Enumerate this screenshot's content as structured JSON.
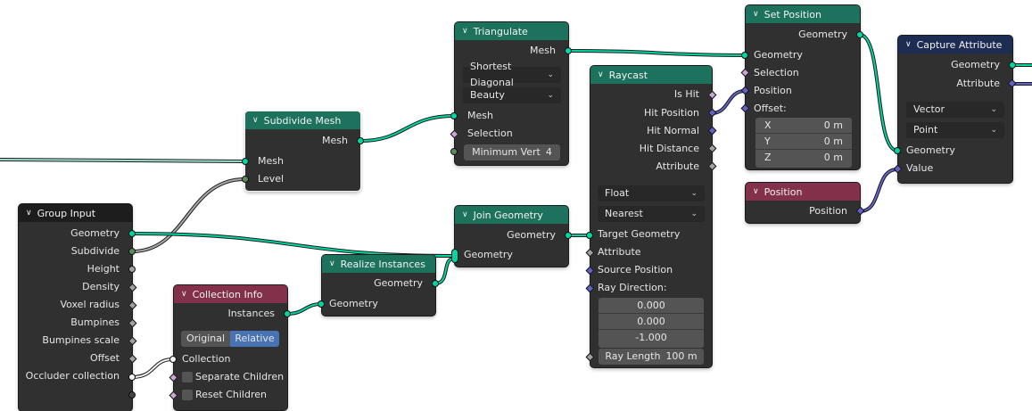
{
  "nodes": {
    "triangulate": {
      "title": "Triangulate",
      "out_mesh": "Mesh",
      "quad_method": "Shortest Diagonal",
      "ngon_method": "Beauty",
      "in_mesh": "Mesh",
      "in_selection": "Selection",
      "min_vert_label": "Minimum Vert",
      "min_vert_value": "4"
    },
    "subdivide": {
      "title": "Subdivide Mesh",
      "out_mesh": "Mesh",
      "in_mesh": "Mesh",
      "in_level": "Level"
    },
    "group_input": {
      "title": "Group Input",
      "outputs": [
        "Geometry",
        "Subdivide",
        "Height",
        "Density",
        "Voxel radius",
        "Bumpines",
        "Bumpines scale",
        "Offset",
        "Occluder collection"
      ]
    },
    "collection_info": {
      "title": "Collection Info",
      "out_instances": "Instances",
      "opt_original": "Original",
      "opt_relative": "Relative",
      "in_collection": "Collection",
      "in_separate": "Separate Children",
      "in_reset": "Reset Children"
    },
    "realize": {
      "title": "Realize Instances",
      "out_geometry": "Geometry",
      "in_geometry": "Geometry"
    },
    "join": {
      "title": "Join Geometry",
      "out_geometry": "Geometry",
      "in_geometry": "Geometry"
    },
    "raycast": {
      "title": "Raycast",
      "outputs": [
        "Is Hit",
        "Hit Position",
        "Hit Normal",
        "Hit Distance",
        "Attribute"
      ],
      "data_type": "Float",
      "mapping": "Nearest",
      "in_target": "Target Geometry",
      "in_attribute": "Attribute",
      "in_source": "Source Position",
      "in_direction": "Ray Direction:",
      "dir_values": [
        "0.000",
        "0.000",
        "-1.000"
      ],
      "ray_length_label": "Ray Length",
      "ray_length_value": "100 m"
    },
    "set_position": {
      "title": "Set Position",
      "out_geometry": "Geometry",
      "in_geometry": "Geometry",
      "in_selection": "Selection",
      "in_position": "Position",
      "in_offset": "Offset:",
      "offset": [
        {
          "axis": "X",
          "value": "0 m"
        },
        {
          "axis": "Y",
          "value": "0 m"
        },
        {
          "axis": "Z",
          "value": "0 m"
        }
      ]
    },
    "position": {
      "title": "Position",
      "out_position": "Position"
    },
    "capture": {
      "title": "Capture Attribute",
      "out_geometry": "Geometry",
      "out_attribute": "Attribute",
      "data_type": "Vector",
      "domain": "Point",
      "in_geometry": "Geometry",
      "in_value": "Value"
    }
  },
  "colors": {
    "geometry_header": "#1d725e",
    "input_header": "#83314a",
    "geometry_socket": "#00d6a3",
    "vector_socket": "#6363c7",
    "wire_geometry": "#00d6a3",
    "wire_vector": "#6363c7"
  }
}
